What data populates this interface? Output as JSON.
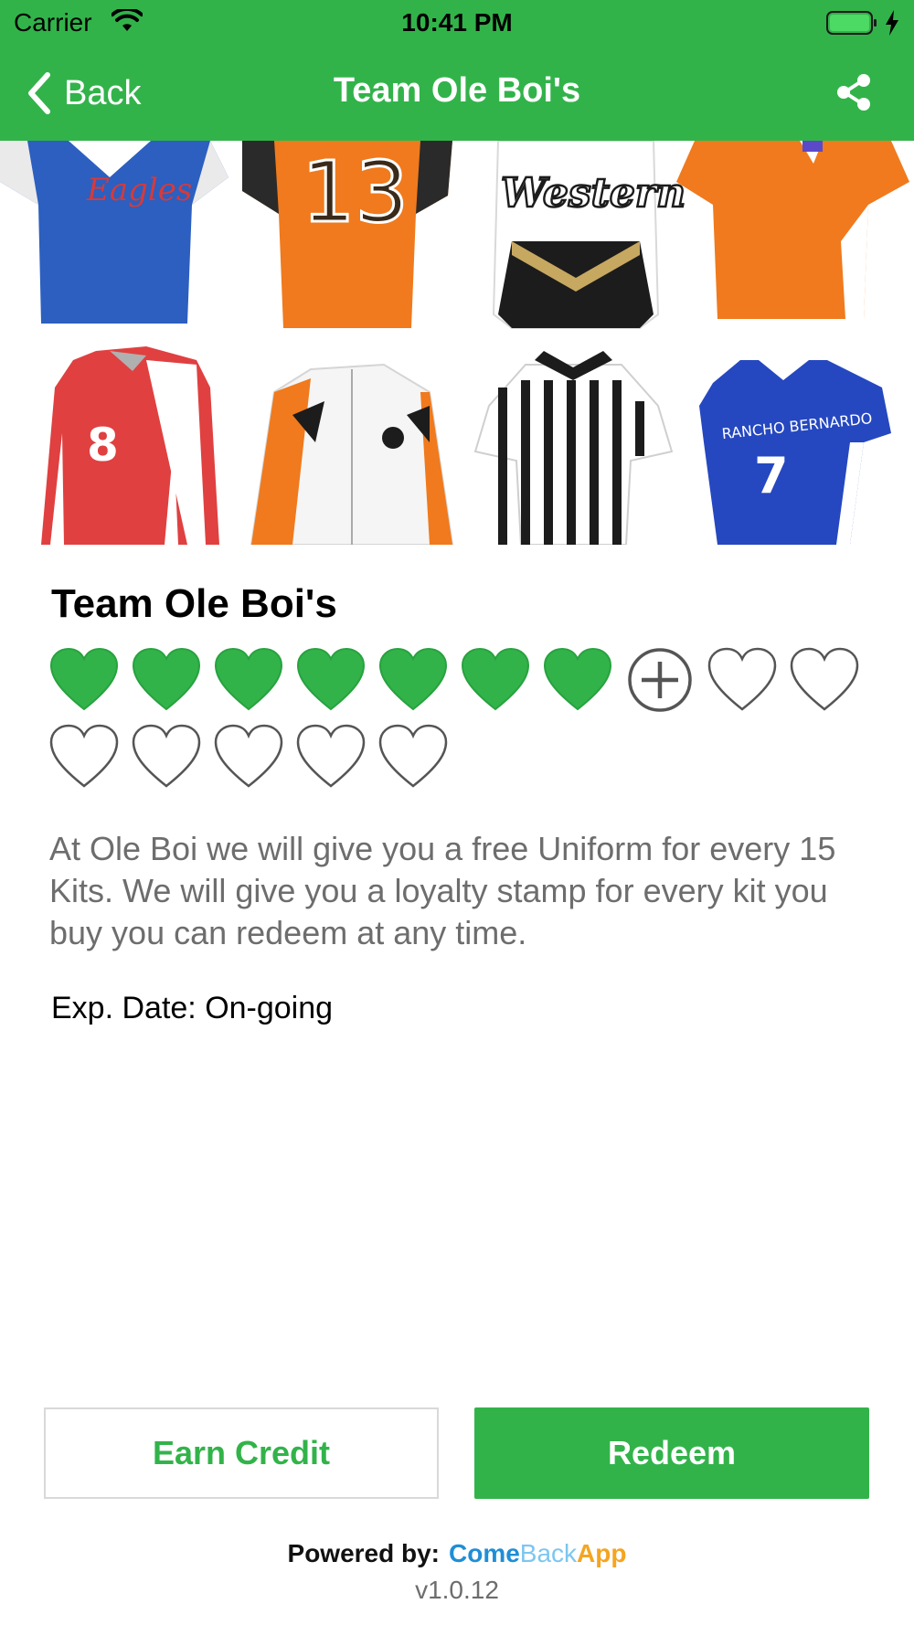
{
  "status_bar": {
    "carrier": "Carrier",
    "time": "10:41 PM"
  },
  "nav": {
    "back_label": "Back",
    "title": "Team Ole Boi's",
    "share_icon": "share-icon"
  },
  "hero": {
    "description_icons": [
      "jersey-blue-eagles",
      "jersey-orange-13",
      "jersey-western",
      "jersey-orange",
      "jersey-red-8",
      "jacket-white-orange",
      "referee-shirt",
      "jersey-blue-7"
    ],
    "jersey_text": [
      "Eagles",
      "13",
      "Western",
      "8",
      "7"
    ]
  },
  "card": {
    "name": "Team Ole Boi's",
    "stamps_total": 15,
    "stamps_filled": 7,
    "stamp_next": "plus-circle-icon",
    "description": "At Ole Boi we will give you a free Uniform for every 15 Kits. We will give you a loyalty stamp for every kit you buy you can redeem at any time.",
    "expiry": "Exp. Date: On-going"
  },
  "actions": {
    "earn_label": "Earn Credit",
    "redeem_label": "Redeem"
  },
  "footer": {
    "powered_label": "Powered by:",
    "brand_part1": "Come",
    "brand_part2": "Back",
    "brand_part3": "App",
    "version": "v1.0.12"
  },
  "colors": {
    "primary_green": "#32b34a",
    "brand_blue": "#1f8ed6",
    "brand_light_blue": "#7cc6f0",
    "brand_orange": "#f4a521"
  }
}
